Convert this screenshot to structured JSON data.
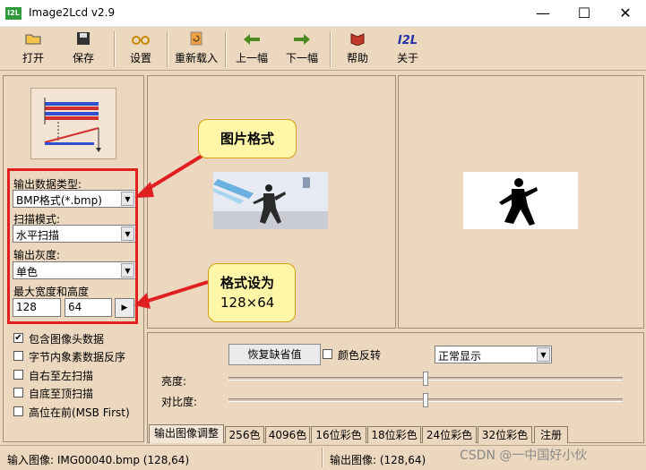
{
  "window": {
    "title": "Image2Lcd v2.9",
    "icon_text": "I2L",
    "controls": {
      "minimize": "—",
      "maximize": "☐",
      "close": "✕"
    }
  },
  "toolbar": {
    "items": [
      {
        "label": "打开",
        "icon": "open-folder-icon"
      },
      {
        "label": "保存",
        "icon": "floppy-disk-icon"
      },
      {
        "label": "设置",
        "icon": "glasses-icon"
      },
      {
        "label": "重新载入",
        "icon": "reload-icon"
      },
      {
        "label": "上一幅",
        "icon": "arrow-left-icon"
      },
      {
        "label": "下一幅",
        "icon": "arrow-right-icon"
      },
      {
        "label": "帮助",
        "icon": "help-book-icon"
      },
      {
        "label": "关于",
        "icon": "about-i2l-icon"
      }
    ],
    "about_glyph": "I2L"
  },
  "left": {
    "output_type_label": "输出数据类型:",
    "output_type_value": "BMP格式(*.bmp)",
    "scan_mode_label": "扫描模式:",
    "scan_mode_value": "水平扫描",
    "gray_label": "输出灰度:",
    "gray_value": "单色",
    "size_label": "最大宽度和高度",
    "max_width": "128",
    "max_height": "64",
    "checkboxes": [
      {
        "label": "包含图像头数据",
        "checked": "✔"
      },
      {
        "label": "字节内象素数据反序",
        "checked": ""
      },
      {
        "label": "自右至左扫描",
        "checked": ""
      },
      {
        "label": "自底至顶扫描",
        "checked": ""
      },
      {
        "label": "高位在前(MSB First)",
        "checked": ""
      }
    ]
  },
  "callouts": {
    "format": "图片格式",
    "size_line1": "格式设为",
    "size_line2": "128×64"
  },
  "bottom": {
    "restore_button": "恢复缺省值",
    "invert_label": "颜色反转",
    "display_mode": "正常显示",
    "brightness_label": "亮度:",
    "contrast_label": "对比度:",
    "brightness_level": 0.5,
    "contrast_level": 0.5,
    "tabs": [
      "输出图像调整",
      "256色",
      "4096色",
      "16位彩色",
      "18位彩色",
      "24位彩色",
      "32位彩色",
      "注册"
    ]
  },
  "status": {
    "input": "输入图像: IMG00040.bmp (128,64)",
    "output": "输出图像: (128,64)"
  },
  "watermark": "CSDN @一中国好小伙",
  "colors": {
    "highlight": "#e02020",
    "callout_bg": "#fff6a8",
    "panel": "#ecd7bf"
  }
}
